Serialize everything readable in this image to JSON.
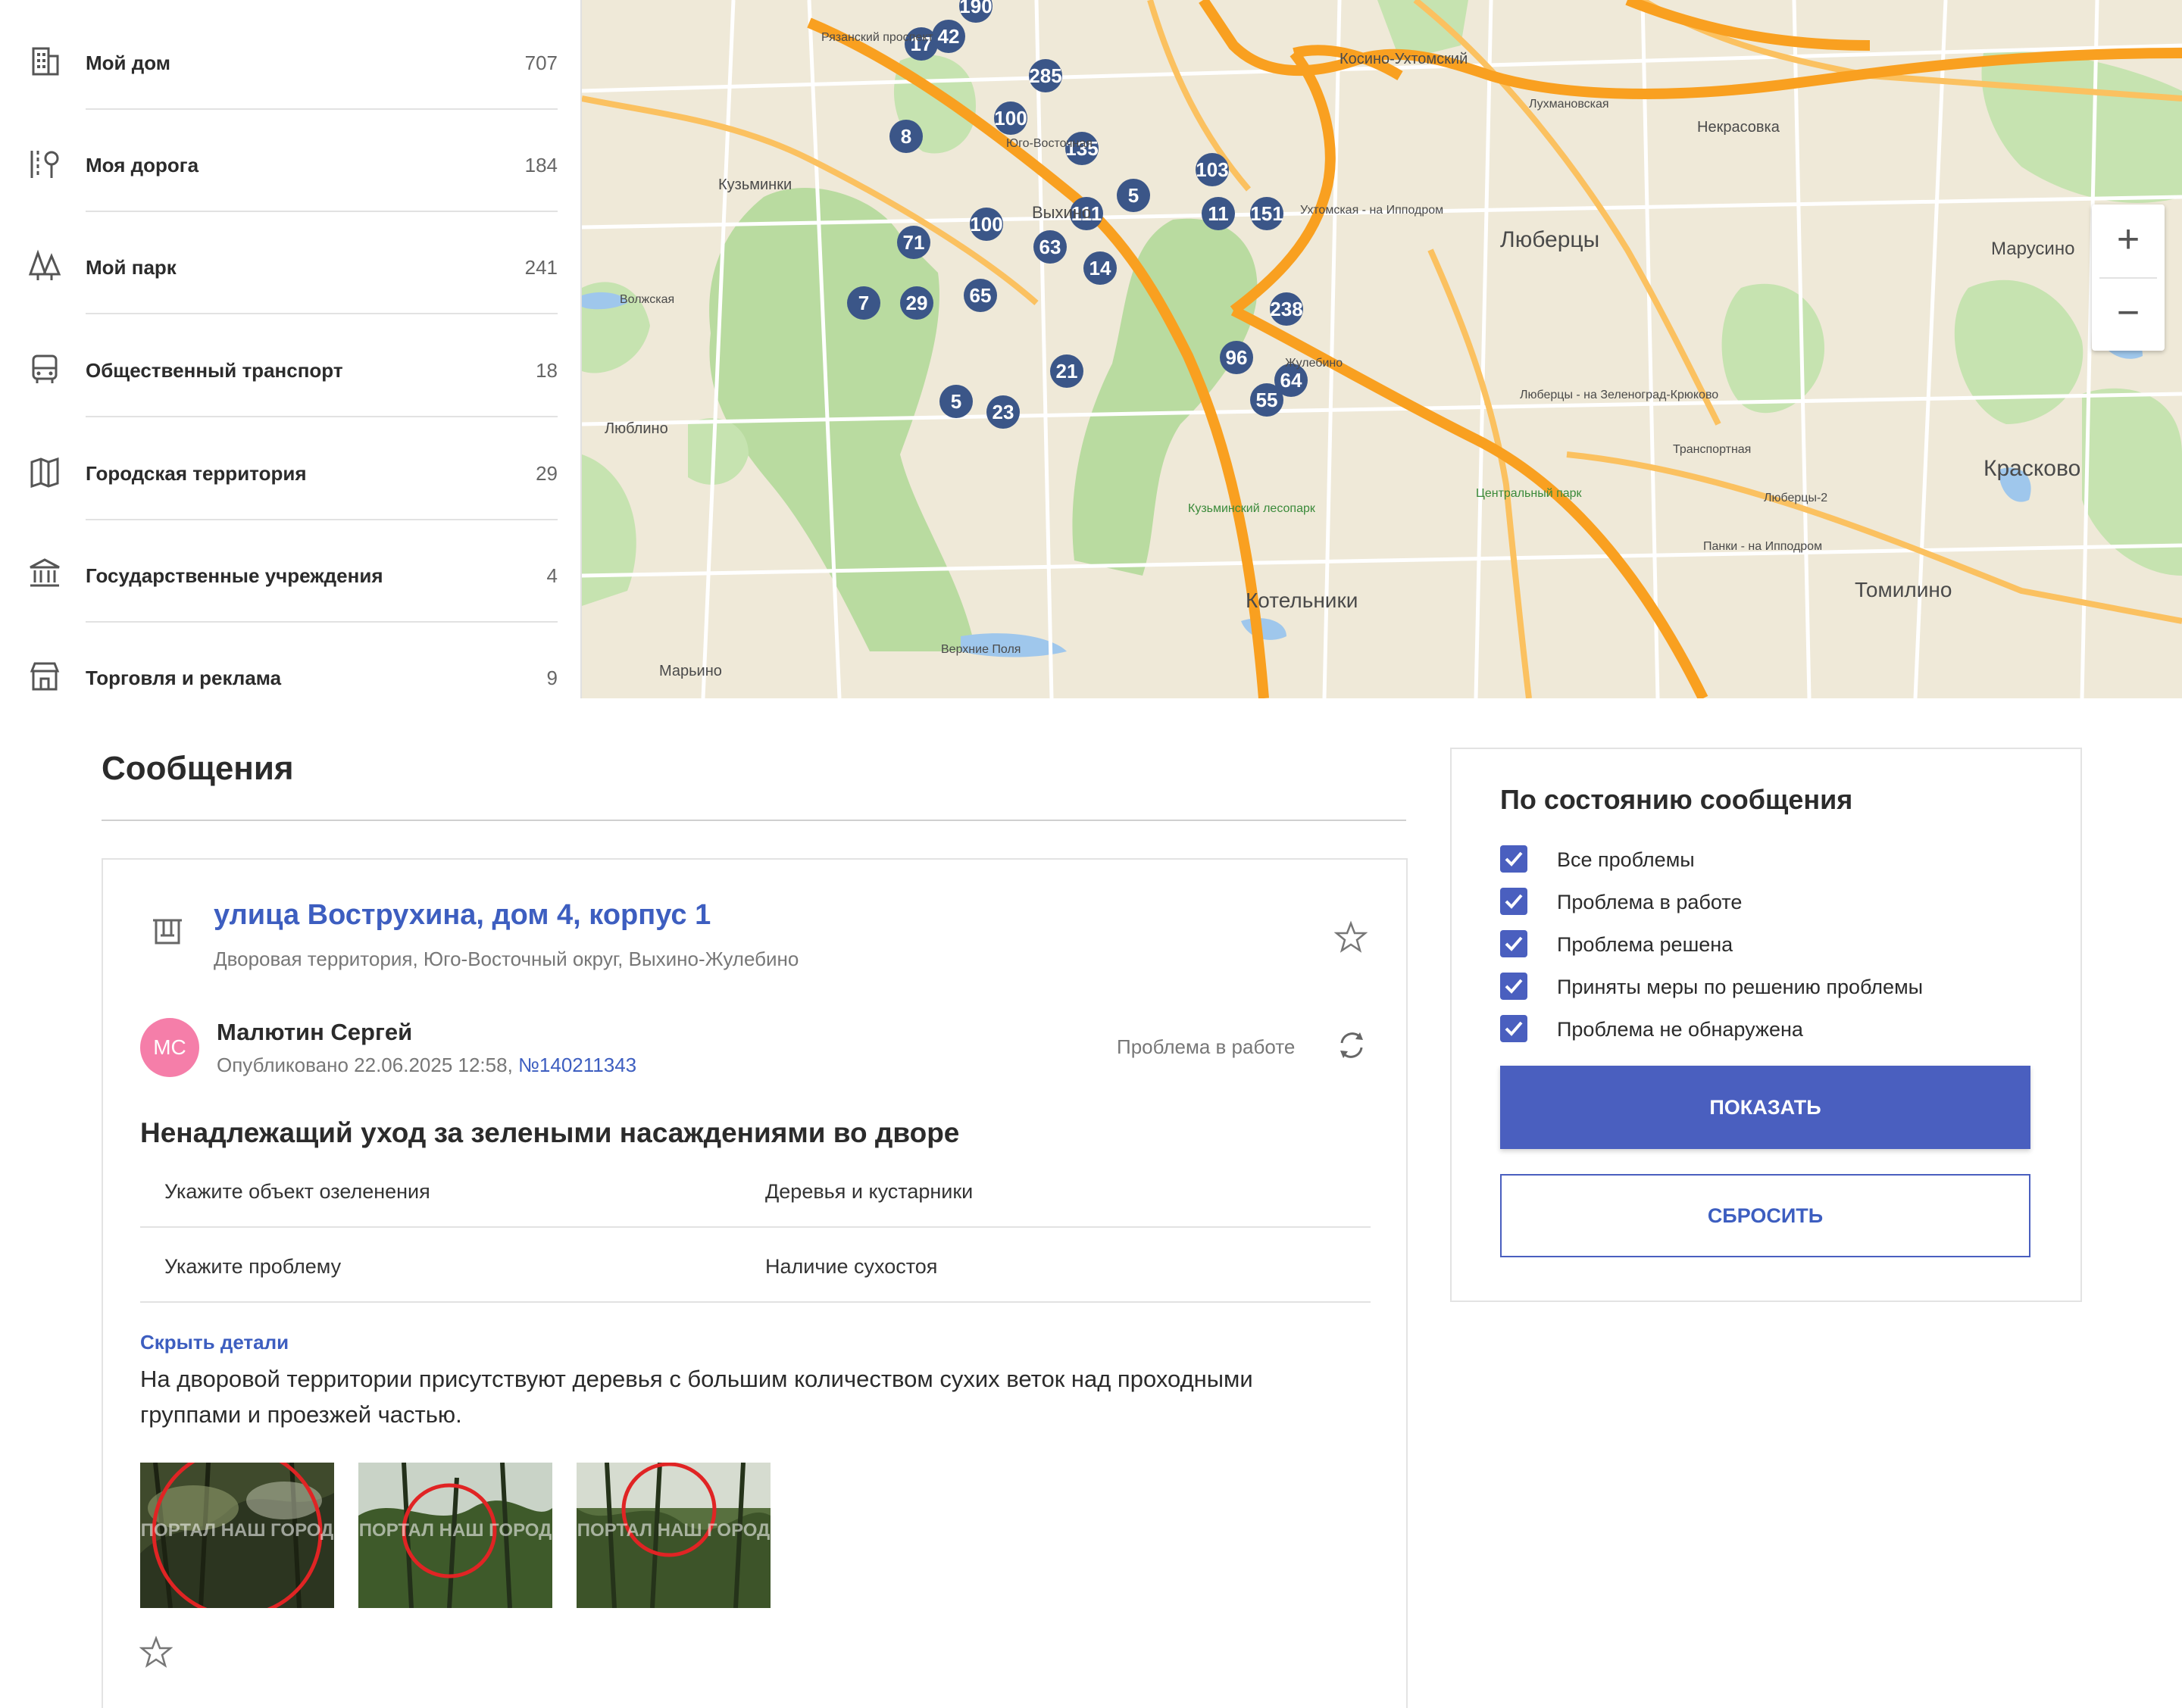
{
  "sidebar": {
    "items": [
      {
        "label": "Мой дом",
        "count": "707",
        "icon": "building-icon"
      },
      {
        "label": "Моя дорога",
        "count": "184",
        "icon": "road-icon"
      },
      {
        "label": "Мой парк",
        "count": "241",
        "icon": "trees-icon"
      },
      {
        "label": "Общественный транспорт",
        "count": "18",
        "icon": "bus-icon"
      },
      {
        "label": "Городская территория",
        "count": "29",
        "icon": "city-map-icon"
      },
      {
        "label": "Государственные учреждения",
        "count": "4",
        "icon": "government-building-icon"
      },
      {
        "label": "Торговля и реклама",
        "count": "9",
        "icon": "shop-icon"
      }
    ]
  },
  "map": {
    "places": [
      "Косино-Ухтомский",
      "Люберцы",
      "Марусино",
      "Кузьминки",
      "Выхино",
      "Котельники",
      "Красково",
      "Томилино",
      "Некрасовка",
      "Люблино",
      "Марьино",
      "Лухмановская",
      "Волжская",
      "Юго-Восточная",
      "Жулебино",
      "Ухтомская - на Ипподром",
      "Люберцы - на Зеленоград-Крюково",
      "Панки - на Ипподром",
      "Люберцы-2",
      "Транспортная",
      "Центральный парк",
      "Кузьминский лесопарк",
      "Верхние Поля",
      "Рязанский проспект"
    ],
    "markers": [
      "190",
      "17",
      "42",
      "285",
      "8",
      "100",
      "135",
      "103",
      "5",
      "111",
      "11",
      "151",
      "100",
      "63",
      "71",
      "14",
      "65",
      "7",
      "29",
      "238",
      "21",
      "96",
      "64",
      "55",
      "5",
      "23"
    ],
    "zoom_in": "+",
    "zoom_out": "−",
    "marker_color": "#3b5688"
  },
  "messages": {
    "title": "Сообщения",
    "card": {
      "address": "улица Вострухина, дом 4, корпус 1",
      "address_sub": "Дворовая территория, Юго-Восточный округ, Выхино-Жулебино",
      "avatar_initials": "МС",
      "author": "Малютин Сергей",
      "published_prefix": "Опубликовано 22.06.2025 12:58, ",
      "number": "№140211343",
      "status": "Проблема в работе",
      "problem_title": "Ненадлежащий уход за зелеными насаждениями во дворе",
      "details": [
        {
          "key": "Укажите объект озеленения",
          "value": "Деревья и кустарники"
        },
        {
          "key": "Укажите проблему",
          "value": "Наличие сухостоя"
        }
      ],
      "toggle_details": "Скрыть детали",
      "description": "На дворовой территории присутствуют деревья с большим количеством сухих веток над проходными группами и проезжей частью.",
      "photo_watermark": "ПОРТАЛ НАШ ГОРОД",
      "accent_color": "#3d5ec0"
    }
  },
  "filter": {
    "title": "По состоянию сообщения",
    "options": [
      {
        "label": "Все проблемы",
        "checked": true
      },
      {
        "label": "Проблема в работе",
        "checked": true
      },
      {
        "label": "Проблема решена",
        "checked": true
      },
      {
        "label": "Приняты меры по решению проблемы",
        "checked": true
      },
      {
        "label": "Проблема не обнаружена",
        "checked": true
      }
    ],
    "show_button": "ПОКАЗАТЬ",
    "reset_button": "СБРОСИТЬ",
    "button_color": "#4a5fbf"
  }
}
